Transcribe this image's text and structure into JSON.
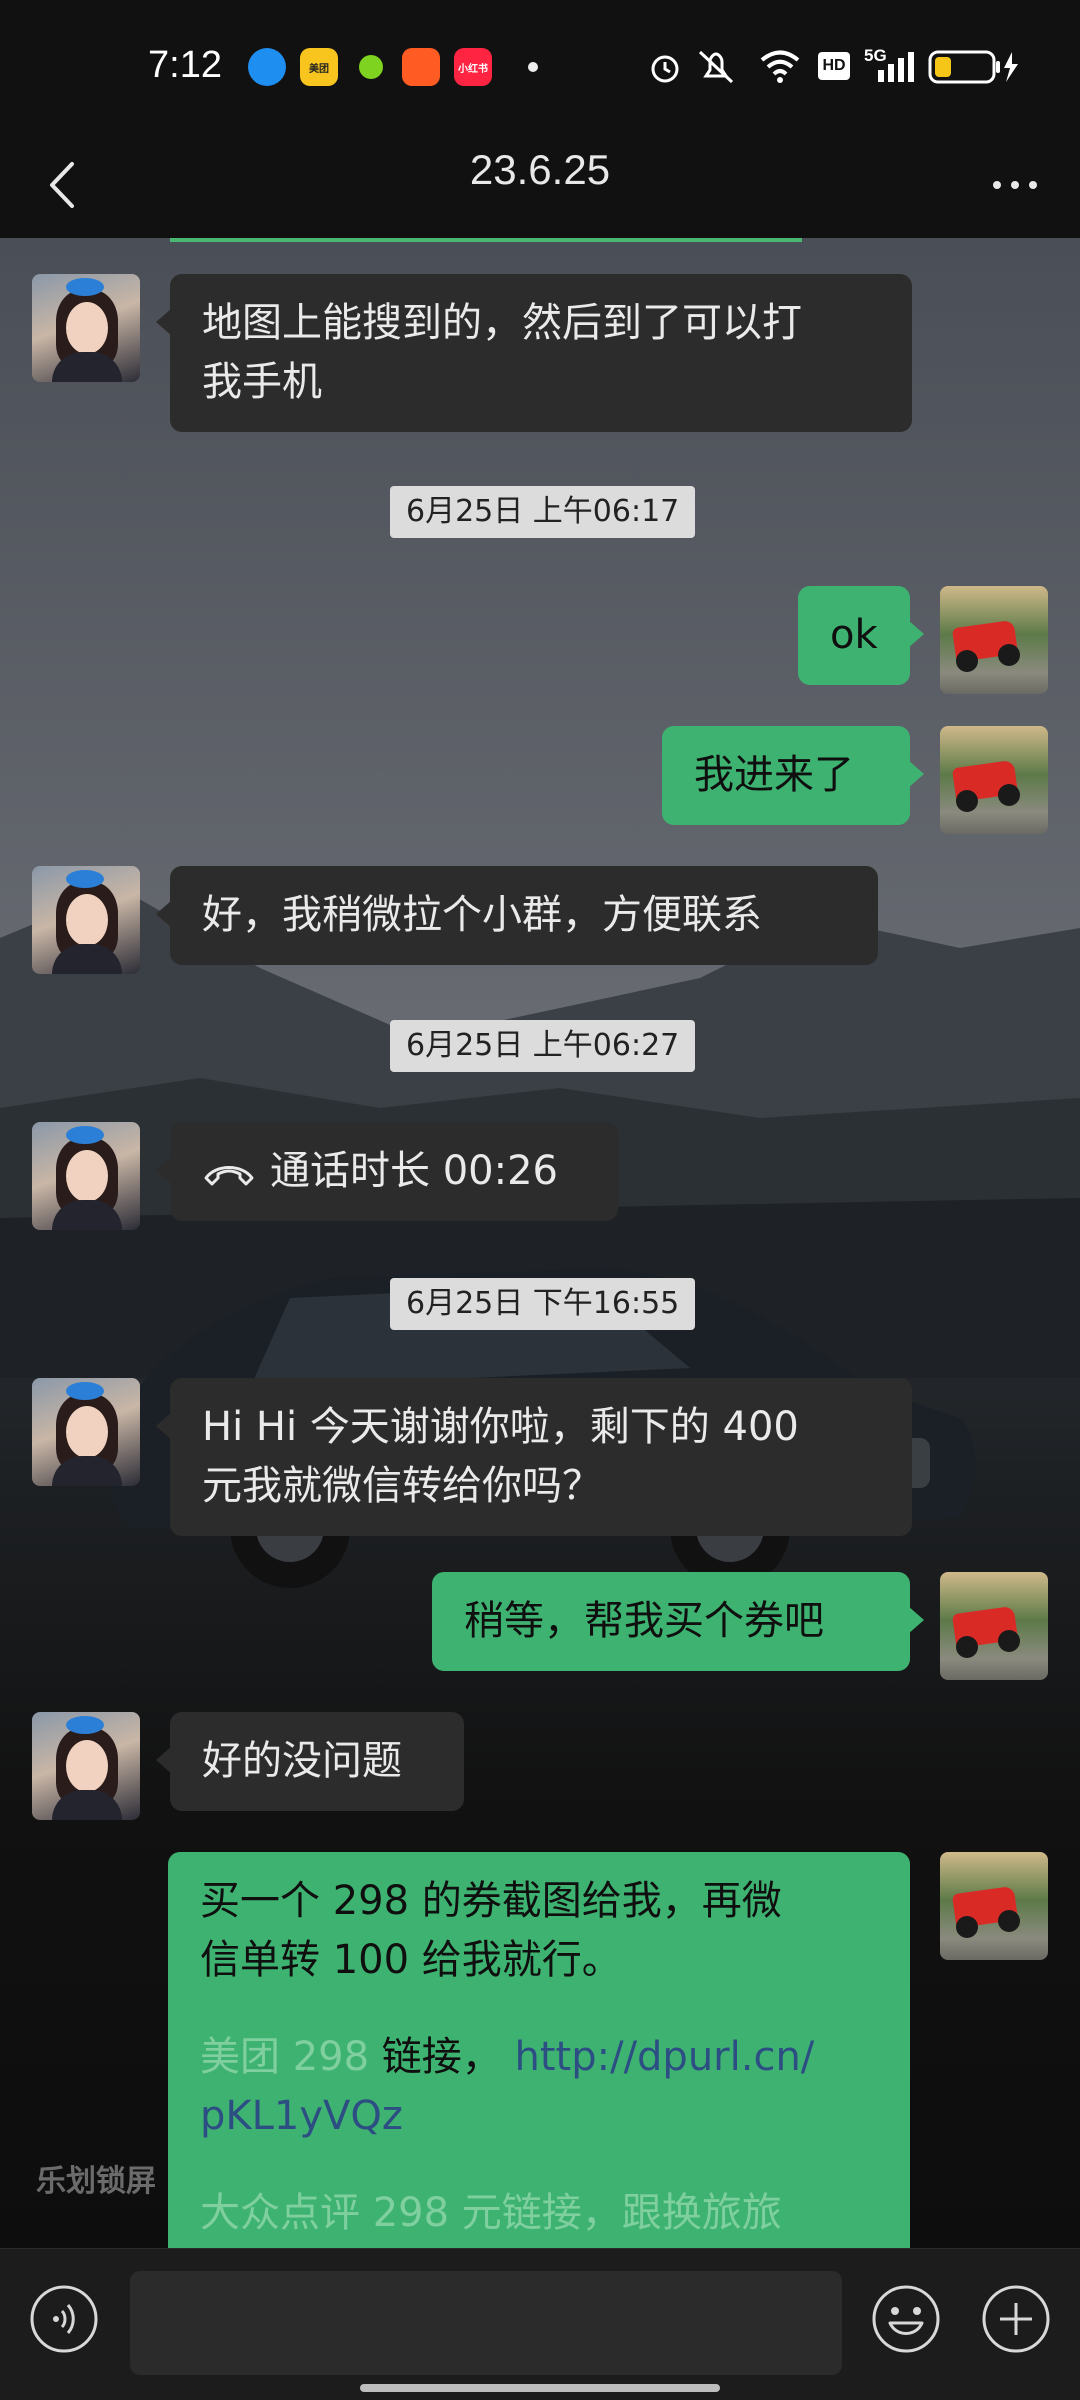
{
  "status_bar": {
    "time": "7:12",
    "network": "5G",
    "hd": "HD",
    "app_icons": [
      {
        "name": "qq-browser-icon",
        "color": "#1f8ef1",
        "label": ""
      },
      {
        "name": "meituan-icon",
        "color": "#f7c51e",
        "label": "美团"
      },
      {
        "name": "green-app-icon",
        "color": "#7ed321",
        "label": ""
      },
      {
        "name": "kuaishou-icon",
        "color": "#ff5b23",
        "label": ""
      },
      {
        "name": "xiaohongshu-icon",
        "color": "#ff2442",
        "label": "小红书"
      }
    ]
  },
  "nav": {
    "title": "23.6.25"
  },
  "messages": [
    {
      "type": "text",
      "from": "other",
      "text": "地图上能搜到的，然后到了可以打\n我手机"
    },
    {
      "type": "time",
      "text": "6月25日 上午06:17"
    },
    {
      "type": "text",
      "from": "me",
      "text": "ok"
    },
    {
      "type": "text",
      "from": "me",
      "text": "我进来了"
    },
    {
      "type": "text",
      "from": "other",
      "text": "好，我稍微拉个小群，方便联系"
    },
    {
      "type": "time",
      "text": "6月25日 上午06:27"
    },
    {
      "type": "call",
      "from": "other",
      "text": "通话时长 00:26"
    },
    {
      "type": "time",
      "text": "6月25日 下午16:55"
    },
    {
      "type": "text",
      "from": "other",
      "text": "Hi Hi 今天谢谢你啦，剩下的 400\n元我就微信转给你吗？"
    },
    {
      "type": "text",
      "from": "me",
      "text": "稍等，帮我买个券吧"
    },
    {
      "type": "text",
      "from": "other",
      "text": "好的没问题"
    },
    {
      "type": "long",
      "from": "me",
      "line1": "买一个 298 的券截图给我，再微",
      "line2": "信单转 100 给我就行。",
      "faint_prefix": "美团 298",
      "link_label": "链接，",
      "url_line1": "http://dpurl.cn/",
      "url_line2": "pKL1yVQz",
      "line_last": "大众点评 298 元链接，跟换旅旅"
    }
  ],
  "watermark": "乐划锁屏",
  "colors": {
    "outgoing_bubble": "#3eb371",
    "incoming_bubble": "#2c2c2c",
    "timestamp_bg": "#dcdcdc",
    "link": "#2d4e83"
  }
}
